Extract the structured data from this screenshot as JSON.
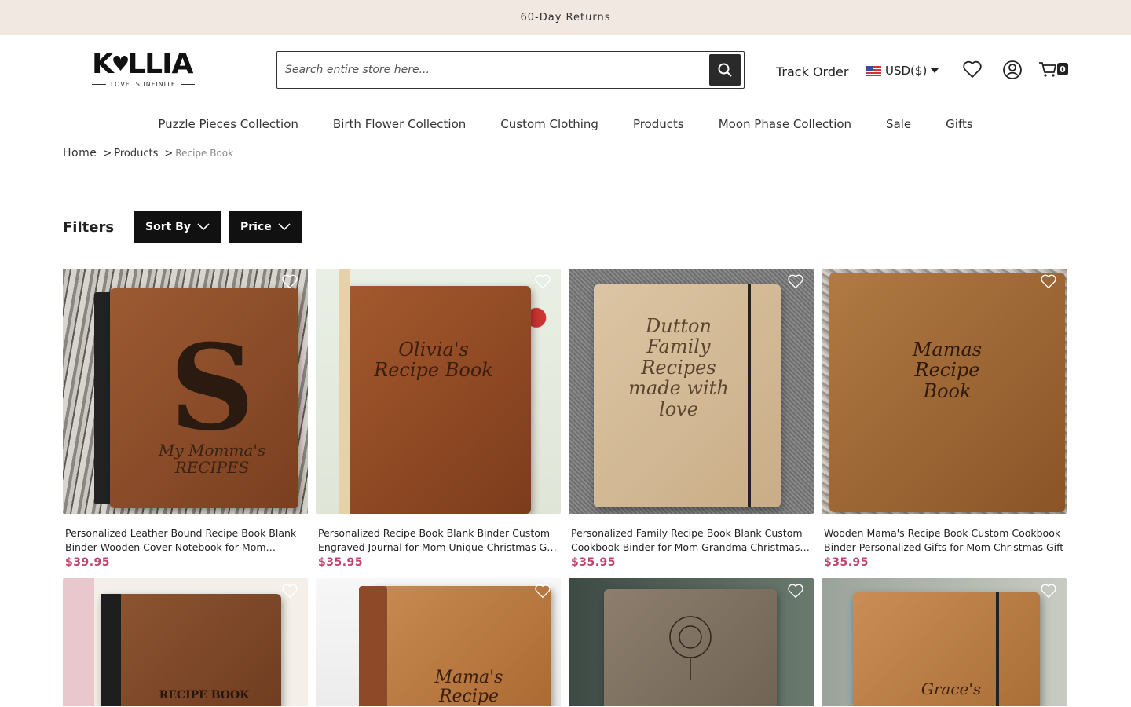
{
  "announcement": "60-Day Returns",
  "brand": {
    "name": "K LLIA",
    "tagline": "LOVE IS INFINITE"
  },
  "search": {
    "placeholder": "Search entire store here..."
  },
  "header": {
    "track_order": "Track Order",
    "currency": "USD($)",
    "cart_count": "0"
  },
  "nav": [
    "Puzzle Pieces Collection",
    "Birth Flower Collection",
    "Custom Clothing",
    "Products",
    "Moon Phase Collection",
    "Sale",
    "Gifts"
  ],
  "breadcrumb": {
    "home": "Home",
    "sep": ">",
    "products": "Products",
    "current": "Recipe Book"
  },
  "filters": {
    "label": "Filters",
    "sort_by": "Sort By",
    "price": "Price"
  },
  "products": [
    {
      "title": "Personalized Leather Bound Recipe Book Blank Binder Wooden Cover Notebook for Mom Grandma Christmas Gift",
      "price": "$39.95",
      "etch": "My Momma's RECIPES"
    },
    {
      "title": "Personalized Recipe Book Blank Binder Custom Engraved Journal for Mom Unique Christmas Gift for Her",
      "price": "$35.95",
      "etch": "Olivia's Recipe Book"
    },
    {
      "title": "Personalized Family Recipe Book Blank Custom Cookbook Binder for Mom Grandma Christmas Gift",
      "price": "$35.95",
      "etch": "Dutton Family Recipes made with love"
    },
    {
      "title": "Wooden Mama's Recipe Book Custom Cookbook Binder Personalized Gifts for Mom Christmas Gift",
      "price": "$35.95",
      "etch": "Mamas Recipe Book"
    },
    {
      "etch": "RECIPE BOOK"
    },
    {
      "etch": "Mama's Recipe"
    },
    {
      "etch": ""
    },
    {
      "etch": "Grace's"
    }
  ],
  "colors": {
    "announce_bg": "#f1e8e2",
    "price": "#c0446b",
    "button": "#111111"
  }
}
